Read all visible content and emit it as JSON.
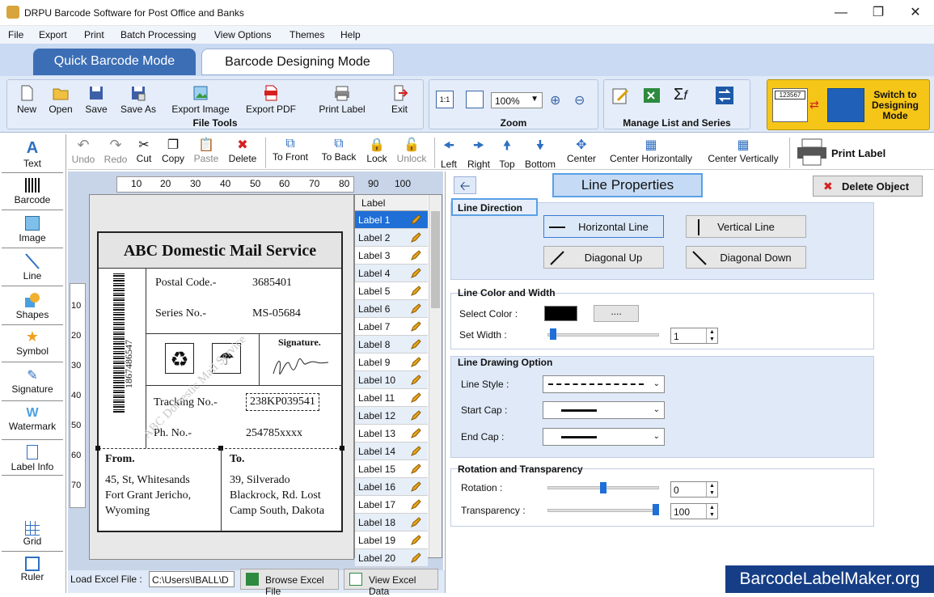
{
  "window": {
    "title": "DRPU Barcode Software for Post Office and Banks"
  },
  "menu": [
    "File",
    "Export",
    "Print",
    "Batch Processing",
    "View Options",
    "Themes",
    "Help"
  ],
  "modes": {
    "quick": "Quick Barcode Mode",
    "designing": "Barcode Designing Mode"
  },
  "file_tools": {
    "label": "File Tools",
    "buttons": [
      "New",
      "Open",
      "Save",
      "Save As",
      "Export Image",
      "Export PDF",
      "Print Label",
      "Exit"
    ]
  },
  "zoom": {
    "label": "Zoom",
    "value": "100%"
  },
  "manage": {
    "label": "Manage List and Series"
  },
  "switch": {
    "label": "Switch to Designing Mode",
    "preview": "123567"
  },
  "edit_toolbar": [
    "Undo",
    "Redo",
    "Cut",
    "Copy",
    "Paste",
    "Delete",
    "To Front",
    "To Back",
    "Lock",
    "Unlock",
    "Left",
    "Right",
    "Top",
    "Bottom",
    "Center",
    "Center Horizontally",
    "Center Vertically"
  ],
  "print_label": "Print Label",
  "tools": [
    "Text",
    "Barcode",
    "Image",
    "Line",
    "Shapes",
    "Symbol",
    "Signature",
    "Watermark",
    "Label Info",
    "Grid",
    "Ruler"
  ],
  "ruler": {
    "top": [
      "10",
      "20",
      "30",
      "40",
      "50",
      "60",
      "70",
      "80",
      "90",
      "100"
    ],
    "left": [
      "10",
      "20",
      "30",
      "40",
      "50",
      "60",
      "70"
    ]
  },
  "card": {
    "title": "ABC Domestic Mail Service",
    "postal_label": "Postal Code.-",
    "postal_value": "3685401",
    "series_label": "Series No.-",
    "series_value": "MS-05684",
    "barcode_text": "1867486547",
    "signature": "Signature.",
    "tracking_label": "Tracking No.-",
    "tracking_value": "238KP039541",
    "phone_label": "Ph. No.-",
    "phone_value": "254785xxxx",
    "watermark": "ABC Domestic Mail Service",
    "from_head": "From.",
    "from": [
      "45, St, Whitesands",
      "Fort Grant Jericho,",
      "Wyoming"
    ],
    "to_head": "To.",
    "to": [
      "39, Silverado",
      "Blackrock, Rd. Lost",
      "Camp South, Dakota"
    ]
  },
  "labels": {
    "header": "Label",
    "items": [
      "Label 1",
      "Label 2",
      "Label 3",
      "Label 4",
      "Label 5",
      "Label 6",
      "Label 7",
      "Label 8",
      "Label 9",
      "Label 10",
      "Label 11",
      "Label 12",
      "Label 13",
      "Label 14",
      "Label 15",
      "Label 16",
      "Label 17",
      "Label 18",
      "Label 19",
      "Label 20"
    ]
  },
  "properties": {
    "title": "Line Properties",
    "delete": "Delete Object",
    "direction": {
      "head": "Line Direction",
      "horizontal": "Horizontal Line",
      "vertical": "Vertical Line",
      "diag_up": "Diagonal Up",
      "diag_down": "Diagonal Down"
    },
    "color_width": {
      "head": "Line Color and Width",
      "select_color": "Select Color :",
      "dots": "....",
      "set_width": "Set Width :",
      "width_value": "1",
      "color": "#000000",
      "width_level": 0.02
    },
    "drawing": {
      "head": "Line Drawing Option",
      "style": "Line Style :",
      "start": "Start Cap :",
      "end": "End Cap :"
    },
    "rotation": {
      "head": "Rotation and Transparency",
      "rotation_label": "Rotation :",
      "rotation_value": "0",
      "rotation_level": 0.5,
      "transparency_label": "Transparency :",
      "transparency_value": "100",
      "transparency_level": 1.0
    }
  },
  "bottom": {
    "load_label": "Load Excel File :",
    "path": "C:\\Users\\IBALL\\D",
    "browse": "Browse Excel File",
    "view": "View Excel Data"
  },
  "brand": "BarcodeLabelMaker.org",
  "colors": {
    "accent": "#163e86",
    "mode_active": "#3b6eb5",
    "selected": "#1f6fd6"
  }
}
